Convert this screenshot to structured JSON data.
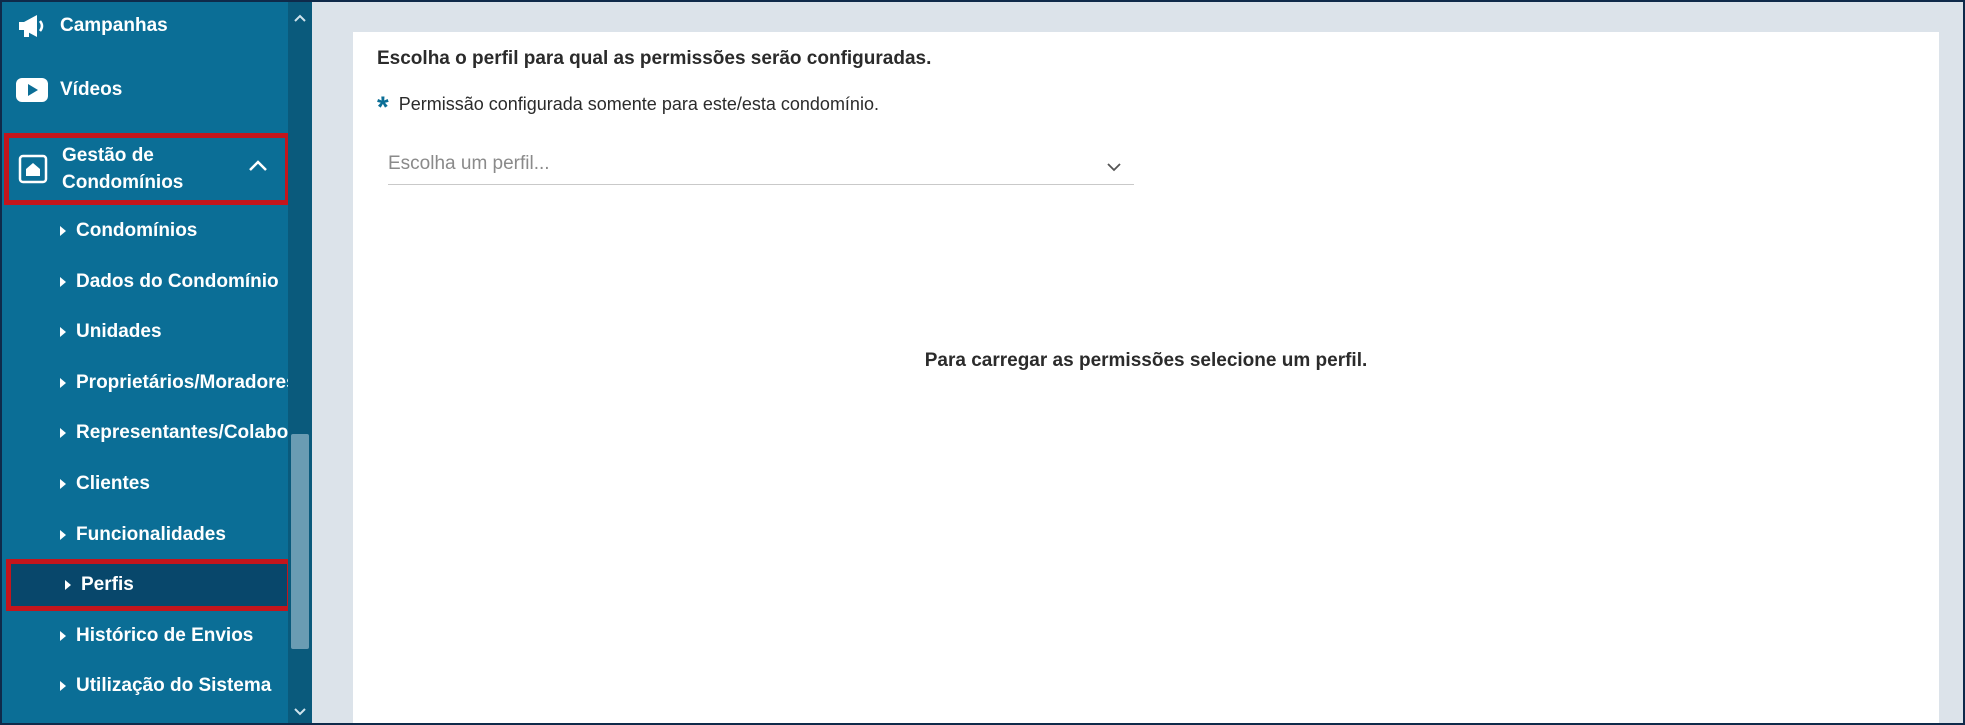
{
  "sidebar": {
    "top_items": [
      {
        "label": "Campanhas",
        "icon": "megaphone-icon"
      },
      {
        "label": "Vídeos",
        "icon": "youtube-icon"
      }
    ],
    "group": {
      "label": "Gestão de Condomínios",
      "icon": "building-icon",
      "expanded": true,
      "items": [
        {
          "label": "Condomínios"
        },
        {
          "label": "Dados do Condomínio"
        },
        {
          "label": "Unidades"
        },
        {
          "label": "Proprietários/Moradores"
        },
        {
          "label": "Representantes/Colaboradores"
        },
        {
          "label": "Clientes"
        },
        {
          "label": "Funcionalidades"
        },
        {
          "label": "Perfis",
          "active": true
        },
        {
          "label": "Histórico de Envios"
        },
        {
          "label": "Utilização do Sistema"
        }
      ]
    }
  },
  "main": {
    "heading": "Escolha o perfil para qual as permissões serão configuradas.",
    "note": "Permissão configurada somente para este/esta condomínio.",
    "profile_select": {
      "placeholder": "Escolha um perfil..."
    },
    "empty_message": "Para carregar as permissões selecione um perfil."
  },
  "colors": {
    "sidebar_bg": "#0b6e96",
    "active_bg": "#08476b",
    "highlight": "#c4151c",
    "accent": "#0b6e96"
  }
}
